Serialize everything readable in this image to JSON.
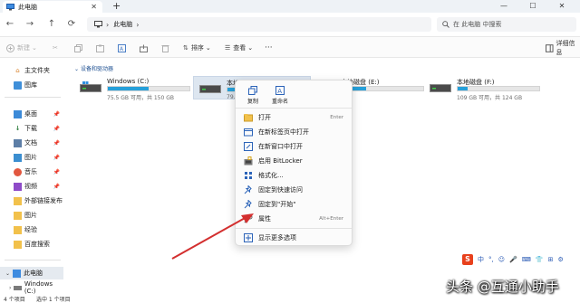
{
  "window": {
    "tab_title": "此电脑",
    "tab_close": "✕",
    "new_tab": "+",
    "controls": {
      "minimize": "—",
      "maximize": "☐",
      "close": "✕"
    }
  },
  "address": {
    "back": "←",
    "forward": "→",
    "up": "↑",
    "refresh": "⟳",
    "path_arrow": "›",
    "path": "此电脑",
    "path_end_arrow": "›",
    "search_placeholder": "在 此电脑 中搜索"
  },
  "toolbar": {
    "new_label": "新建",
    "sort_label": "排序",
    "view_label": "查看",
    "more": "···",
    "details_label": "详细信息"
  },
  "sidebar": {
    "items": [
      {
        "label": "主文件夹",
        "icon": "home-icon"
      },
      {
        "label": "图库",
        "icon": "gallery-icon"
      },
      {
        "label": "桌面",
        "icon": "desktop-icon"
      },
      {
        "label": "下载",
        "icon": "download-icon"
      },
      {
        "label": "文档",
        "icon": "document-icon"
      },
      {
        "label": "图片",
        "icon": "pictures-icon"
      },
      {
        "label": "音乐",
        "icon": "music-icon"
      },
      {
        "label": "视频",
        "icon": "video-icon"
      },
      {
        "label": "外部链接发布",
        "icon": "folder-icon"
      },
      {
        "label": "图片",
        "icon": "folder-icon"
      },
      {
        "label": "经验",
        "icon": "folder-icon"
      },
      {
        "label": "百度搜索",
        "icon": "folder-icon"
      },
      {
        "label": "此电脑",
        "icon": "computer-icon"
      },
      {
        "label": "Windows (C:)",
        "icon": "drive-icon"
      }
    ]
  },
  "main": {
    "group_title": "设备和驱动器",
    "drives": [
      {
        "name": "Windows (C:)",
        "size": "75.5 GB 可用，共 150 GB",
        "used": 0.5
      },
      {
        "name": "本地磁盘 (D:)",
        "size": "79.3",
        "used": 0.55
      },
      {
        "name": "本地磁盘 (E:)",
        "size": "",
        "used": 0.3
      },
      {
        "name": "本地磁盘 (F:)",
        "size": "109 GB 可用，共 124 GB",
        "used": 0.12
      }
    ]
  },
  "context_menu": {
    "quick_actions": [
      {
        "label": "复制",
        "icon": "copy-icon"
      },
      {
        "label": "重命名",
        "icon": "rename-icon"
      }
    ],
    "items": [
      {
        "label": "打开",
        "shortcut": "Enter",
        "icon": "folder-open-icon"
      },
      {
        "label": "在新标签页中打开",
        "shortcut": "",
        "icon": "new-tab-icon"
      },
      {
        "label": "在新窗口中打开",
        "shortcut": "",
        "icon": "new-window-icon"
      },
      {
        "label": "启用 BitLocker",
        "shortcut": "",
        "icon": "bitlocker-icon"
      },
      {
        "label": "格式化...",
        "shortcut": "",
        "icon": "format-icon"
      },
      {
        "label": "固定到快速访问",
        "shortcut": "",
        "icon": "pin-icon"
      },
      {
        "label": "固定到\"开始\"",
        "shortcut": "",
        "icon": "pin-icon"
      },
      {
        "label": "属性",
        "shortcut": "Alt+Enter",
        "icon": "wrench-icon"
      },
      {
        "label": "显示更多选项",
        "shortcut": "",
        "icon": "more-options-icon"
      }
    ]
  },
  "statusbar": {
    "count": "4 个项目",
    "selected": "选中 1 个项目"
  },
  "ime": {
    "logo": "S",
    "items": [
      "中",
      "°,",
      "☺",
      "🎤",
      "⌨",
      "👕",
      "⊞",
      "⚙"
    ]
  },
  "watermark": "头条 @互通小助手",
  "colors": {
    "accent": "#26a0da",
    "arrow": "#d32f2f",
    "highlight": "#dde6f0"
  }
}
